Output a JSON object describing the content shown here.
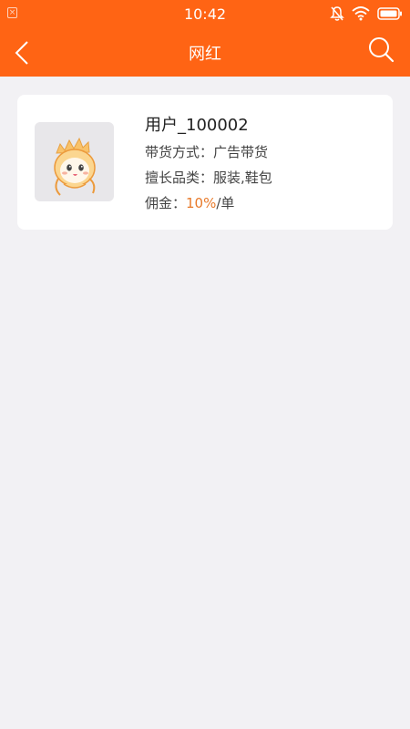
{
  "status_bar": {
    "time": "10:42",
    "left_icon": "close-box-icon",
    "right_icons": [
      "mute-icon",
      "wifi-icon",
      "battery-icon"
    ]
  },
  "header": {
    "title": "网红",
    "back_icon": "chevron-left-icon",
    "search_icon": "search-icon",
    "background": "#ff6414"
  },
  "influencer": {
    "username": "用户_100002",
    "sales_method_label": "带货方式：",
    "sales_method_value": "广告带货",
    "category_label": "擅长品类：",
    "category_value": "服装,鞋包",
    "commission_label": "佣金：",
    "commission_value": "10%",
    "commission_unit": "/单",
    "accent": "#e87a2a"
  }
}
